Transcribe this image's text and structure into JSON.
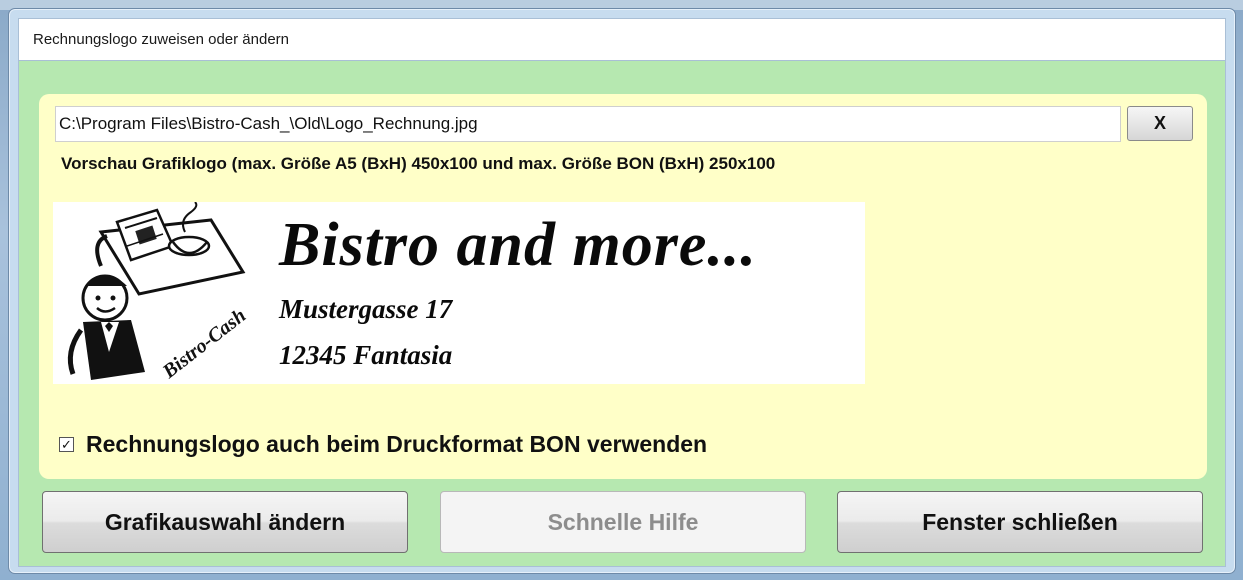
{
  "window": {
    "title": "Rechnungslogo zuweisen oder ändern"
  },
  "file": {
    "path": "C:\\Program Files\\Bistro-Cash_\\Old\\Logo_Rechnung.jpg",
    "clear_label": "X"
  },
  "preview": {
    "label": "Vorschau Grafiklogo (max. Größe A5 (BxH) 450x100 und max. Größe BON (BxH) 250x100",
    "logo": {
      "title": "Bistro and more...",
      "street": "Mustergasse 17",
      "city": "12345 Fantasia",
      "brand_text": "Bistro-Cash"
    }
  },
  "options": {
    "use_on_bon_label": "Rechnungslogo auch beim Druckformat BON verwenden",
    "use_on_bon_checked": true,
    "check_glyph": "✓"
  },
  "buttons": {
    "change_graphic": "Grafikauswahl ändern",
    "quick_help": "Schnelle Hilfe",
    "quick_help_enabled": false,
    "close_window": "Fenster schließen"
  },
  "colors": {
    "client_bg": "#b6e8b0",
    "panel_bg": "#ffffc8",
    "disabled_text": "#8d8d8d"
  }
}
